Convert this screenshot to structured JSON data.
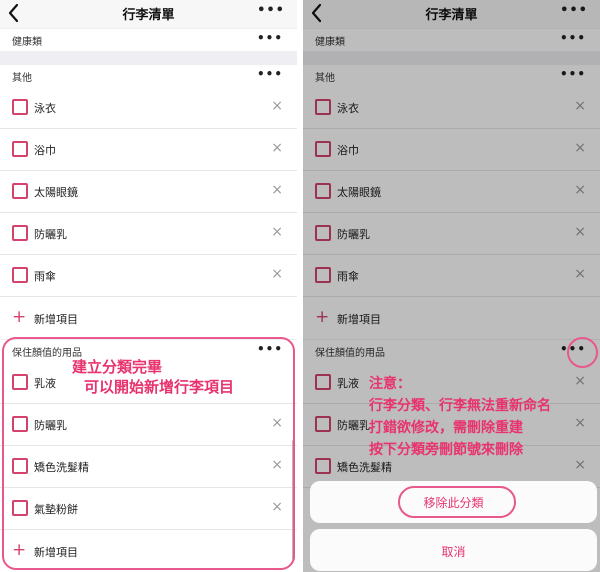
{
  "nav": {
    "title": "行李清單",
    "more": "•••"
  },
  "left": {
    "categories": [
      {
        "name": "健康類",
        "more": "•••"
      },
      {
        "name": "其他",
        "more": "•••"
      },
      {
        "name": "保住顏值的用品",
        "more": "•••"
      }
    ],
    "other_items": [
      "泳衣",
      "浴巾",
      "太陽眼鏡",
      "防曬乳",
      "雨傘"
    ],
    "beauty_items": [
      "乳液",
      "防曬乳",
      "矯色洗髮精",
      "氣墊粉餅"
    ],
    "delete_icon": "×",
    "add_plus": "+",
    "add_label": "新增項目",
    "note_line1": "建立分類完畢",
    "note_line2": "可以開始新增行李項目"
  },
  "right": {
    "categories": [
      {
        "name": "健康類",
        "more": "•••"
      },
      {
        "name": "其他",
        "more": "•••"
      },
      {
        "name": "保住顏值的用品",
        "more": "•••"
      }
    ],
    "other_items": [
      "泳衣",
      "浴巾",
      "太陽眼鏡",
      "防曬乳",
      "雨傘"
    ],
    "beauty_items": [
      "乳液",
      "防曬乳",
      "矯色洗髮精"
    ],
    "delete_icon": "×",
    "add_plus": "+",
    "add_label": "新增項目",
    "sheet_remove": "移除此分類",
    "sheet_cancel": "取消",
    "note_title": "注意：",
    "note_line1": "行李分類、行李無法重新命名",
    "note_line2": "打錯欲修改，需刪除重建",
    "note_line3": "按下分類旁刪節號來刪除"
  },
  "colors": {
    "accent": "#d3436c",
    "annotation": "#e8336e",
    "separator": "#efeff3"
  }
}
